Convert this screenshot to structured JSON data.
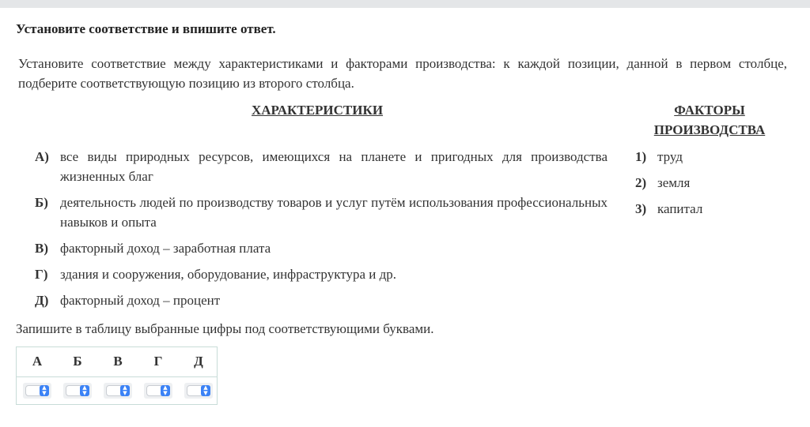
{
  "task": {
    "title": "Установите соответствие и впишите ответ.",
    "intro": "Установите соответствие между характеристиками и факторами производства: к каждой позиции, данной в первом столбце, подберите соответствующую позицию из второго столбца."
  },
  "columns": {
    "left_header": "ХАРАКТЕРИСТИКИ",
    "right_header_line1": "ФАКТОРЫ",
    "right_header_line2": "ПРОИЗВОДСТВА"
  },
  "characteristics": [
    {
      "letter": "А)",
      "text": "все виды природных ресурсов, имеющихся на планете и пригодных для производства жизненных благ"
    },
    {
      "letter": "Б)",
      "text": "деятельность людей по производству товаров и услуг путём использования профессиональных навыков и опыта"
    },
    {
      "letter": "В)",
      "text": "факторный доход –  заработная плата"
    },
    {
      "letter": "Г)",
      "text": "здания и сооружения, оборудование, инфраструктура и др."
    },
    {
      "letter": "Д)",
      "text": "факторный доход –  процент"
    }
  ],
  "factors": [
    {
      "num": "1)",
      "text": "труд"
    },
    {
      "num": "2)",
      "text": "земля"
    },
    {
      "num": "3)",
      "text": "капитал"
    }
  ],
  "instruction": "Запишите в таблицу выбранные цифры под соответствующими буквами.",
  "answer_table": {
    "headers": [
      "А",
      "Б",
      "В",
      "Г",
      "Д"
    ],
    "selected_values": [
      "",
      "",
      "",
      "",
      ""
    ]
  }
}
